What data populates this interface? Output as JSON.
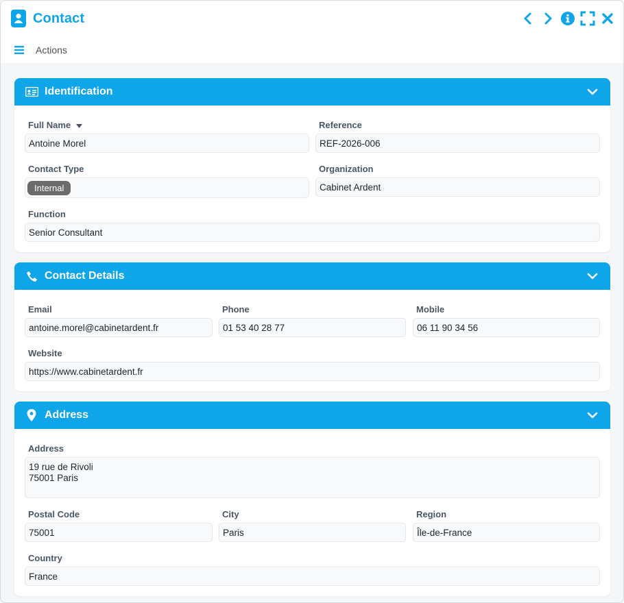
{
  "window": {
    "title": "Contact",
    "controls": [
      "chevron-left-icon",
      "chevron-right-icon",
      "info-icon",
      "expand-icon",
      "close-icon"
    ]
  },
  "toolbar": {
    "actions_label": "Actions"
  },
  "colors": {
    "accent": "#0ea5e9",
    "badge": "#6b6b6b"
  },
  "sections": {
    "identification": {
      "title": "Identification",
      "full_name_label": "Full Name",
      "full_name_value": "Antoine Morel",
      "reference_label": "Reference",
      "reference_value": "REF-2026-006",
      "contact_type_label": "Contact Type",
      "contact_type_value": "Internal",
      "organization_label": "Organization",
      "organization_value": "Cabinet Ardent",
      "function_label": "Function",
      "function_value": "Senior Consultant"
    },
    "contact_details": {
      "title": "Contact Details",
      "email_label": "Email",
      "email_value": "antoine.morel@cabinetardent.fr",
      "phone_label": "Phone",
      "phone_value": "01 53 40 28 77",
      "mobile_label": "Mobile",
      "mobile_value": "06 11 90 34 56",
      "website_label": "Website",
      "website_value": "https://www.cabinetardent.fr"
    },
    "address": {
      "title": "Address",
      "address_label": "Address",
      "address_value": "19 rue de Rivoli\n75001 Paris",
      "postal_code_label": "Postal Code",
      "postal_code_value": "75001",
      "city_label": "City",
      "city_value": "Paris",
      "region_label": "Region",
      "region_value": "Île-de-France",
      "country_label": "Country",
      "country_value": "France"
    }
  }
}
